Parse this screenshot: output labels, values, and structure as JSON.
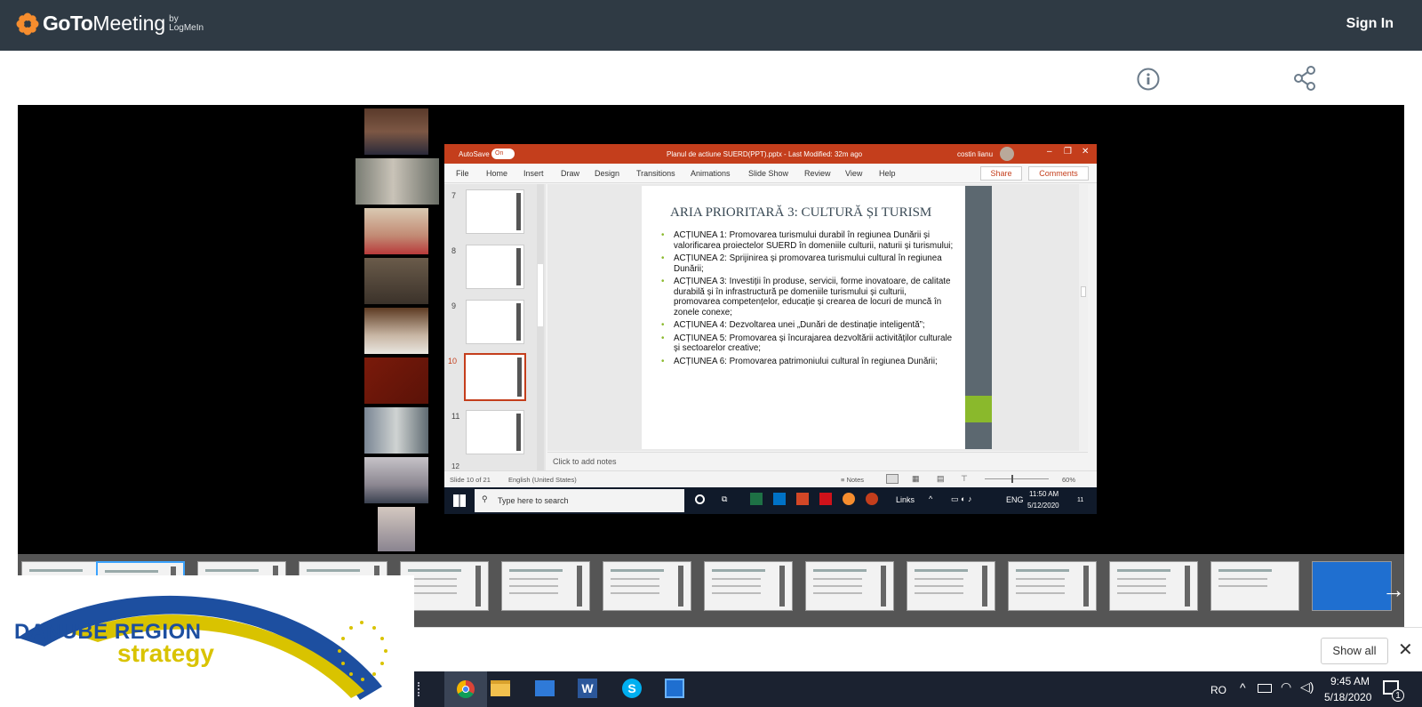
{
  "app": {
    "brand_go": "GoTo",
    "brand_meeting": "Meeting",
    "brand_by": "by",
    "brand_logmein": "LogMeIn",
    "sign_in": "Sign In"
  },
  "ppt": {
    "autosave": "AutoSave",
    "autosave_state": "On",
    "title": "Planul de actiune SUERD(PPT).pptx  -  Last Modified: 32m ago",
    "user": "costin lianu",
    "menu": [
      "File",
      "Home",
      "Insert",
      "Draw",
      "Design",
      "Transitions",
      "Animations",
      "Slide Show",
      "Review",
      "View",
      "Help"
    ],
    "share": "Share",
    "comments": "Comments",
    "thumbs": [
      "7",
      "8",
      "9",
      "10",
      "11",
      "12"
    ],
    "slide": {
      "title": "ARIA PRIORITARĂ 3: CULTURĂ ȘI TURISM",
      "bullets": [
        "ACȚIUNEA 1: Promovarea turismului durabil în regiunea Dunării și valorificarea proiectelor SUERD în domeniile culturii, naturii și turismului;",
        "ACȚIUNEA 2: Sprijinirea și promovarea turismului cultural în regiunea Dunării;",
        "ACȚIUNEA 3: Investiții în produse, servicii, forme inovatoare, de calitate durabilă și în infrastructură pe domeniile turismului și culturii, promovarea competențelor, educație și crearea de locuri de muncă în zonele conexe;",
        "ACȚIUNEA 4: Dezvoltarea unei „Dunări de destinație inteligentă”;",
        "ACȚIUNEA 5: Promovarea și încurajarea dezvoltării activităților culturale și sectoarelor creative;",
        "ACȚIUNEA 6: Promovarea patrimoniului cultural în regiunea Dunării;"
      ]
    },
    "notes": "Click to add notes",
    "status": {
      "slide": "Slide 10 of 21",
      "lang": "English (United States)",
      "notes": "Notes",
      "zoom": "60%"
    }
  },
  "inner_taskbar": {
    "search": "Type here to search",
    "links": "Links",
    "eng": "ENG",
    "time": "11:50 AM",
    "date": "5/12/2020",
    "notif": "11"
  },
  "logo": {
    "line1": "DANUBE REGION",
    "line2": "strategy"
  },
  "download_bar": {
    "show_all": "Show all"
  },
  "taskbar": {
    "lang": "RO",
    "time": "9:45 AM",
    "date": "5/18/2020",
    "notif": "1"
  },
  "colors": {
    "header": "#2f3a44",
    "ppt_red": "#c43e1c",
    "accent_green": "#8ab92c",
    "logo_blue": "#1d4fa0",
    "logo_yellow": "#d9c300"
  }
}
